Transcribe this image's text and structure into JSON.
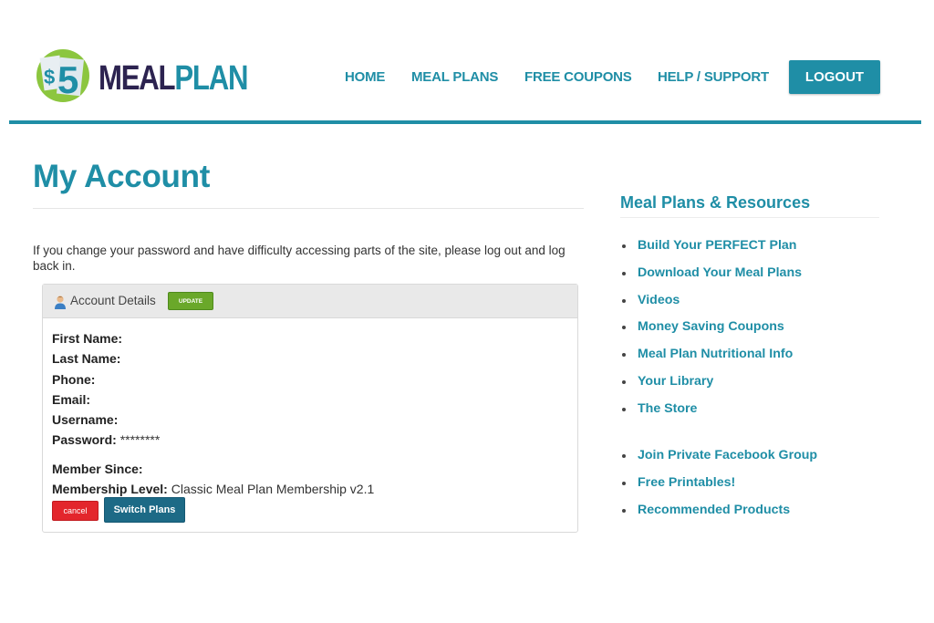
{
  "brand": {
    "badge_text": "$5",
    "name_part1": "MEAL",
    "name_part2": "PLAN"
  },
  "nav": {
    "items": [
      {
        "label": "HOME"
      },
      {
        "label": "MEAL PLANS"
      },
      {
        "label": "FREE COUPONS"
      },
      {
        "label": "HELP / SUPPORT"
      }
    ],
    "logout_label": "LOGOUT"
  },
  "main": {
    "title": "My Account",
    "notice": "If you change your password and have difficulty accessing parts of the site, please log out and log back in.",
    "panel": {
      "title": "Account Details",
      "update_label": "UPDATE",
      "icon": "user-icon",
      "fields": [
        {
          "label": "First Name:",
          "value": ""
        },
        {
          "label": "Last Name:",
          "value": ""
        },
        {
          "label": "Phone:",
          "value": ""
        },
        {
          "label": "Email:",
          "value": ""
        },
        {
          "label": "Username:",
          "value": ""
        },
        {
          "label": "Password:",
          "value": " ********"
        },
        {
          "label": "Member Since:",
          "value": ""
        },
        {
          "label": "Membership Level:",
          "value": " Classic Meal Plan Membership v2.1"
        }
      ],
      "cancel_label": "cancel",
      "switch_label": "Switch Plans"
    }
  },
  "sidebar": {
    "title": "Meal Plans & Resources",
    "group1": [
      {
        "label": "Build Your PERFECT Plan"
      },
      {
        "label": "Download Your Meal Plans"
      },
      {
        "label": "Videos"
      },
      {
        "label": "Money Saving Coupons"
      },
      {
        "label": "Meal Plan Nutritional Info"
      },
      {
        "label": "Your Library"
      },
      {
        "label": "The Store"
      }
    ],
    "group2": [
      {
        "label": "Join Private Facebook Group"
      },
      {
        "label": "Free Printables!"
      },
      {
        "label": "Recommended Products"
      }
    ]
  },
  "colors": {
    "accent": "#1f8ea6",
    "brand_dark": "#2c2350",
    "update_green": "#6aa82a",
    "cancel_red": "#e3262c",
    "switch_blue": "#1d6a86"
  }
}
